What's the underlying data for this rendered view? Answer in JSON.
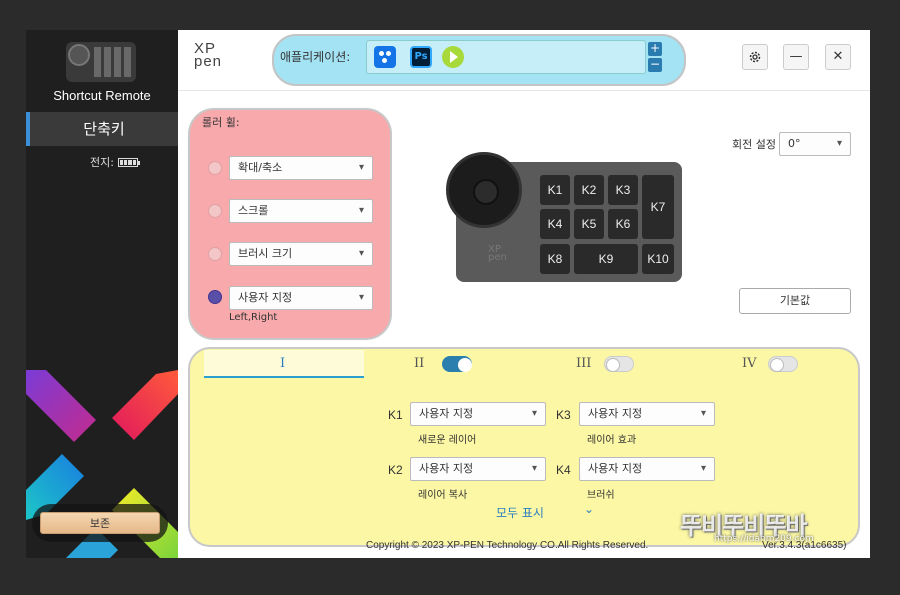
{
  "sidebar": {
    "device_name": "Shortcut Remote",
    "active_item": "단축키",
    "battery_label": "전지:",
    "save_label": "보존"
  },
  "header": {
    "logo_text": "XP pen",
    "app_label": "애플리케이션:",
    "apps": [
      {
        "icon": "settings-app-icon"
      },
      {
        "icon": "photoshop-icon",
        "text": "Ps"
      },
      {
        "icon": "play-app-icon"
      }
    ],
    "add": "+",
    "remove": "−",
    "minimize": "—",
    "close": "✕"
  },
  "roller": {
    "title": "롤러 휠:",
    "options": [
      {
        "label": "확대/축소",
        "selected": false
      },
      {
        "label": "스크롤",
        "selected": false
      },
      {
        "label": "브러시 크기",
        "selected": false
      },
      {
        "label": "사용자 지정",
        "selected": true,
        "note": "Left,Right"
      }
    ]
  },
  "device": {
    "keys": [
      "K1",
      "K2",
      "K3",
      "K4",
      "K5",
      "K6",
      "K7",
      "K8",
      "K9",
      "K10"
    ],
    "logo": "XP pen"
  },
  "rotation": {
    "label": "회전 설정",
    "value": "0°"
  },
  "default_button": "기본값",
  "key_panel": {
    "tabs": [
      {
        "label": "I",
        "active": true
      },
      {
        "label": "II",
        "toggle_on": true
      },
      {
        "label": "III",
        "toggle_on": false
      },
      {
        "label": "IV",
        "toggle_on": false
      }
    ],
    "keys": [
      {
        "key": "K1",
        "value": "사용자 지정",
        "note": "새로운 레이어"
      },
      {
        "key": "K3",
        "value": "사용자 지정",
        "note": "레이어 효과"
      },
      {
        "key": "K2",
        "value": "사용자 지정",
        "note": "레이어 복사"
      },
      {
        "key": "K4",
        "value": "사용자 지정",
        "note": "브러쉬"
      }
    ],
    "show_all": "모두 표시"
  },
  "footer": {
    "copyright": "Copyright © 2023 XP-PEN Technology CO.All Rights Reserved.",
    "version": "Ver.3.4.3(a1c6635)"
  },
  "watermark": {
    "text": "뚜비뚜비뚜바",
    "url": "https://idanm209.com"
  },
  "colors": {
    "roller_highlight": "#f7a9ac",
    "app_bar_highlight": "#a4e3f4",
    "keys_panel_highlight": "#fbf7a4",
    "accent": "#2b7fc0"
  }
}
